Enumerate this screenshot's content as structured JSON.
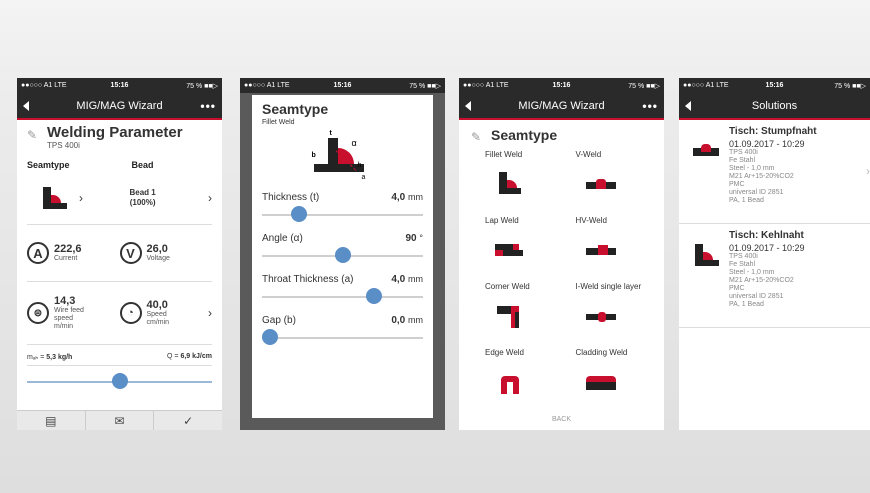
{
  "colors": {
    "accent": "#c8102e",
    "dark": "#2a2a2a",
    "slider": "#5a8ec7"
  },
  "status": {
    "carrier": "●●○○○ A1  LTE",
    "time": "15:16",
    "battery": "75 % ■■▷"
  },
  "phone1": {
    "nav_title": "MIG/MAG Wizard",
    "more": "•••",
    "title": "Welding Parameter",
    "subtitle": "TPS 400i",
    "col_seamtype": "Seamtype",
    "col_bead": "Bead",
    "bead_line1": "Bead 1",
    "bead_line2": "(100%)",
    "current_value": "222,6",
    "current_unit": "Current",
    "current_icon_letter": "A",
    "voltage_value": "26,0",
    "voltage_unit": "Voltage",
    "voltage_icon_letter": "V",
    "wire_value": "14,3",
    "wire_unit": "Wire feed speed m/min",
    "speed_value": "40,0",
    "speed_unit": "Speed cm/min",
    "mab_label": "mₐₕ =",
    "mab_value": "5,3 kg/h",
    "q_label": "Q =",
    "q_value": "6,9 kJ/cm",
    "slider_level": 0.5,
    "tabs": [
      {
        "icon": "document-icon"
      },
      {
        "icon": "mail-icon"
      },
      {
        "icon": "check-icon"
      }
    ]
  },
  "phone2": {
    "title": "Seamtype",
    "subtitle": "Fillet Weld",
    "diagram_labels": {
      "t": "t",
      "b": "b",
      "alpha": "α",
      "h": "h",
      "a": "a"
    },
    "params": [
      {
        "label": "Thickness (t)",
        "value": "4,0",
        "unit": "mm",
        "level": 0.2
      },
      {
        "label": "Angle (α)",
        "value": "90",
        "unit": "°",
        "level": 0.5
      },
      {
        "label": "Throat Thickness (a)",
        "value": "4,0",
        "unit": "mm",
        "level": 0.72
      },
      {
        "label": "Gap (b)",
        "value": "0,0",
        "unit": "mm",
        "level": 0.0
      }
    ]
  },
  "phone3": {
    "nav_title": "MIG/MAG Wizard",
    "more": "•••",
    "title": "Seamtype",
    "types": [
      {
        "label": "Fillet Weld",
        "icon": "fillet-weld-icon"
      },
      {
        "label": "V-Weld",
        "icon": "v-weld-icon"
      },
      {
        "label": "Lap Weld",
        "icon": "lap-weld-icon"
      },
      {
        "label": "HV-Weld",
        "icon": "hv-weld-icon"
      },
      {
        "label": "Corner Weld",
        "icon": "corner-weld-icon"
      },
      {
        "label": "I-Weld single layer",
        "icon": "i-weld-icon"
      },
      {
        "label": "Edge Weld",
        "icon": "edge-weld-icon"
      },
      {
        "label": "Cladding Weld",
        "icon": "cladding-weld-icon"
      }
    ],
    "back": "BACK"
  },
  "phone4": {
    "nav_title": "Solutions",
    "solutions": [
      {
        "title": "Tisch: Stumpfnaht",
        "date": "01.09.2017 - 10:29",
        "lines": [
          "TPS 400i",
          "Fe Stahl",
          "Steel - 1,0 mm",
          "M21 Ar+15-20%CO2",
          "PMC",
          "universal ID 2851",
          "PA, 1 Bead"
        ]
      },
      {
        "title": "Tisch: Kehlnaht",
        "date": "01.09.2017 - 10:29",
        "lines": [
          "TPS 400i",
          "Fe Stahl",
          "Steel - 1,0 mm",
          "M21 Ar+15-20%CO2",
          "PMC",
          "universal ID 2851",
          "PA, 1 Bead"
        ]
      }
    ]
  }
}
